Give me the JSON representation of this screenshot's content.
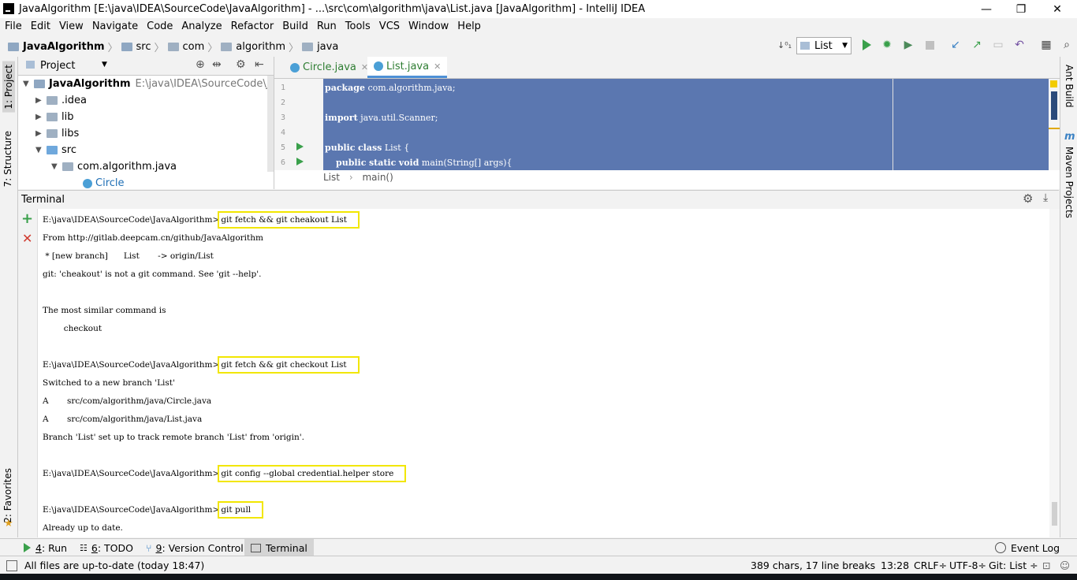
{
  "window": {
    "title": "JavaAlgorithm [E:\\java\\IDEA\\SourceCode\\JavaAlgorithm] - ...\\src\\com\\algorithm\\java\\List.java [JavaAlgorithm] - IntelliJ IDEA",
    "minimize": "—",
    "maximize": "❐",
    "close": "✕"
  },
  "menu": [
    "File",
    "Edit",
    "View",
    "Navigate",
    "Code",
    "Analyze",
    "Refactor",
    "Build",
    "Run",
    "Tools",
    "VCS",
    "Window",
    "Help"
  ],
  "breadcrumb": [
    "JavaAlgorithm",
    "src",
    "com",
    "algorithm",
    "java"
  ],
  "toolbar": {
    "run_config": "List",
    "icons": [
      "build-icon",
      "run-icon",
      "debug-icon",
      "coverage-icon",
      "stop-icon",
      "vcs-update-icon",
      "vcs-commit-icon",
      "vcs-compare-icon",
      "revert-icon",
      "project-structure-icon",
      "search-icon"
    ]
  },
  "project_panel": {
    "title": "Project",
    "tree": [
      {
        "label": "JavaAlgorithm",
        "path": "E:\\java\\IDEA\\SourceCode\\JavaAl",
        "expanded": true
      },
      {
        "label": ".idea",
        "expanded": false
      },
      {
        "label": "lib",
        "expanded": false
      },
      {
        "label": "libs",
        "expanded": false
      },
      {
        "label": "src",
        "expanded": true
      },
      {
        "label": "com.algorithm.java",
        "expanded": true
      },
      {
        "label": "Circle"
      }
    ]
  },
  "editor": {
    "tabs": [
      {
        "label": "Circle.java",
        "active": false
      },
      {
        "label": "List.java",
        "active": true
      }
    ],
    "lines": [
      {
        "no": "1",
        "text": "package com.algorithm.java;"
      },
      {
        "no": "2",
        "text": ""
      },
      {
        "no": "3",
        "text": "import java.util.Scanner;"
      },
      {
        "no": "4",
        "text": ""
      },
      {
        "no": "5",
        "text": "public class List {"
      },
      {
        "no": "6",
        "text": "    public static void main(String[] args){"
      }
    ],
    "code_breadcrumb": [
      "List",
      "main()"
    ]
  },
  "terminal": {
    "title": "Terminal",
    "lines": [
      {
        "prompt": "E:\\java\\IDEA\\SourceCode\\JavaAlgorithm>",
        "cmd": "git fetch && git cheakout List"
      },
      {
        "text": "From http://gitlab.deepcam.cn/github/JavaAlgorithm"
      },
      {
        "text": " * [new branch]      List       -> origin/List"
      },
      {
        "text": "git: 'cheakout' is not a git command. See 'git --help'."
      },
      {
        "text": ""
      },
      {
        "text": "The most similar command is"
      },
      {
        "text": "        checkout"
      },
      {
        "text": ""
      },
      {
        "prompt": "E:\\java\\IDEA\\SourceCode\\JavaAlgorithm>",
        "cmd": "git fetch && git checkout List"
      },
      {
        "text": "Switched to a new branch 'List'"
      },
      {
        "text": "A       src/com/algorithm/java/Circle.java"
      },
      {
        "text": "A       src/com/algorithm/java/List.java"
      },
      {
        "text": "Branch 'List' set up to track remote branch 'List' from 'origin'."
      },
      {
        "text": ""
      },
      {
        "prompt": "E:\\java\\IDEA\\SourceCode\\JavaAlgorithm>",
        "cmd": "git config --global credential.helper store"
      },
      {
        "text": ""
      },
      {
        "prompt": "E:\\java\\IDEA\\SourceCode\\JavaAlgorithm>",
        "cmd": "git pull"
      },
      {
        "text": "Already up to date."
      }
    ]
  },
  "left_tabs": [
    "1: Project",
    "7: Structure",
    "2: Favorites"
  ],
  "right_tabs": [
    "Ant Build",
    "Maven Projects"
  ],
  "bottom_tabs": [
    {
      "key": "4",
      "label": ": Run"
    },
    {
      "key": "6",
      "label": ": TODO"
    },
    {
      "key": "9",
      "label": ": Version Control"
    },
    {
      "key": "",
      "label": "Terminal"
    }
  ],
  "event_log": "Event Log",
  "status": {
    "message": "All files are up-to-date (today 18:47)",
    "chars": "389 chars, 17 line breaks",
    "position": "13:28",
    "line_sep": "CRLF÷",
    "encoding": "UTF-8÷",
    "git": "Git: List ÷"
  },
  "colors": {
    "selection": "#5b77b0",
    "highlight_box": "#f2e600",
    "run_green": "#3aa04b",
    "tab_active": "#4d90d6"
  }
}
